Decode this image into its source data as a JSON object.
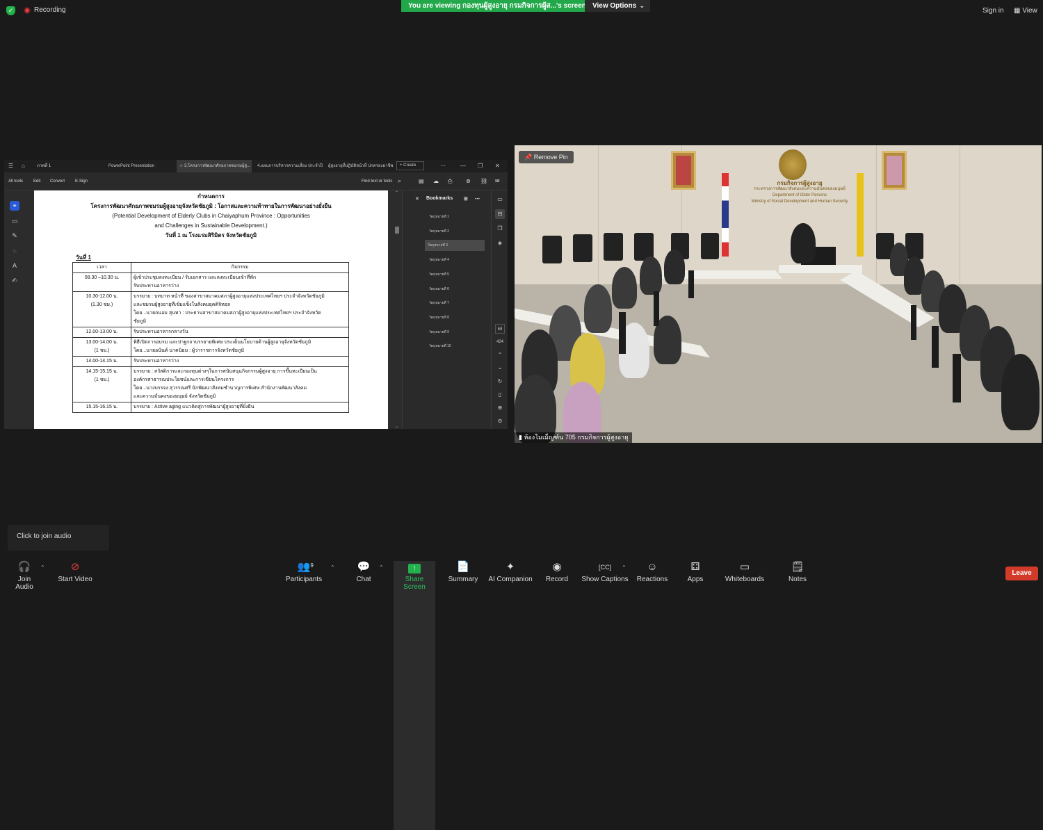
{
  "topbar": {
    "recording_label": "Recording",
    "viewing_banner": "You are viewing กองทุนผู้สูงอายุ กรมกิจการผู้ส...'s screen",
    "view_options_label": "View Options",
    "sign_in_label": "Sign in",
    "view_label": "View"
  },
  "shared_screen": {
    "tabs": [
      {
        "label": "ภาพที่ 1"
      },
      {
        "label": "PowerPoint Presentation"
      },
      {
        "label": "3.โครงการพัฒนาศักยภาพชมรมผู้สู..."
      },
      {
        "label": "4.แผนการบริหารความเสี่ยง ประจำปีง..."
      },
      {
        "label": "ผู้สูงอายุที่ปฏิบัติหน้าที่ ปกครองอาชีพ..."
      },
      {
        "label": "+ Create"
      }
    ],
    "toolbar": {
      "all_tools": "All tools",
      "edit": "Edit",
      "convert": "Convert",
      "esign": "E-Sign",
      "find": "Find text or tools"
    },
    "document": {
      "heading": "กำหนดการ",
      "title_line": "โครงการพัฒนาศักยภาพชมรมผู้สูงอายุจังหวัดชัยภูมิ : โอกาสและความท้าทายในการพัฒนาอย่างยั่งยืน",
      "subtitle_line1": "(Potential Development of Elderly Clubs in  Chaiyaphum Province : Opportunities",
      "subtitle_line2": "and Challenges in Sustainable Development.)",
      "venue_line": "วันที่  1 ณ  โรงแรมสิริมิตร จังหวัดชัยภูมิ",
      "day_label": "วันที่ 1",
      "col_time": "เวลา",
      "col_activity": "กิจกรรม",
      "rows": [
        {
          "time": "08.30 –10.30 น.",
          "activity": [
            "ผู้เข้าประชุมลงทะเบียน / รับเอกสาร และลงทะเบียนเข้าที่พัก",
            "รับประทานอาหารว่าง"
          ]
        },
        {
          "time": "10.30-12.00 น.\n(1.30 ชม.)",
          "activity": [
            "บรรยาย : บทบาท หน้าที่ ของสาขาสมาคมสภาผู้สูงอายุแห่งประเทศไทยฯ ประจำจังหวัดชัยภูมิ",
            "และชมรมผู้สูงอายุที่เข้มแข็งในสังคมยุคดิจิทอล",
            "โดย...นายถนอม  สุนทา : ประธานสาขาสมาคมสภาผู้สูงอายุแห่งประเทศไทยฯ ประจำจังหวัด",
            "ชัยภูมิ"
          ]
        },
        {
          "time": "12.00-13.00 น.",
          "activity": [
            "รับประทานอาหารกลางวัน"
          ]
        },
        {
          "time": "13.00-14.00 น.\n(1 ชม.)",
          "activity": [
            "พิธีเปิดการอบรม  และปาฐกถาบรรยายพิเศษ ประเด็นนโยบายด้านผู้สูงอายุจังหวัดชัยภูมิ",
            "โดย...นายอนันต์   นาคนิยม : ผู้ว่าราชการจังหวัดชัยภูมิ"
          ]
        },
        {
          "time": "14.00-14.15 น.",
          "activity": [
            "รับประทานอาหารว่าง"
          ]
        },
        {
          "time": "14.15-15.15 น.\n(1 ชม.)",
          "activity": [
            "บรรยาย : สวัสดิการและกองทุนต่างๆในการสนับสนุนกิจกรรมผู้สูงอายุ การขึ้นทะเบียนเป็น",
            "องค์กรสาธารณประโยชน์และการเขียนโครงการ",
            "โดย...นางบรรจง สุวรรณศรี นักพัฒนาสังคมชำนาญการพิเศษ สำนักงานพัฒนาสังคม",
            "และความมั่นคงของมนุษย์ จังหวัดชัยภูมิ"
          ]
        },
        {
          "time": "15.15-16.15 น.",
          "activity": [
            "บรรยาย : Active aging แนวคิดสู่การพัฒนาผู้สูงอายุที่ยั่งยืน"
          ]
        }
      ]
    },
    "bookmarks": {
      "title": "Bookmarks",
      "items": [
        "วัตถุหมายที่ 1",
        "วัตถุหมายที่ 2",
        "วัตถุหมายที่ 3",
        "วัตถุหมายที่ 4",
        "วัตถุหมายที่ 5",
        "วัตถุหมายที่ 6",
        "วัตถุหมายที่ 7",
        "วัตถุหมายที่ 8",
        "วัตถุหมายที่ 9",
        "วัตถุหมายที่ 10"
      ],
      "selected_index": 2
    },
    "page_indicator": {
      "current": "59",
      "total": "424"
    }
  },
  "video": {
    "remove_pin_label": "Remove Pin",
    "caption": "ห้องโมเม็ญฑ์น 705 กรมกิจการผู้สูงอายุ",
    "sign_line1": "กรมกิจการผู้สูงอายุ",
    "sign_line2": "กระทรวงการพัฒนาสังคมและความมั่นคงของมนุษย์",
    "sign_line3": "Department of Older Persons",
    "sign_line4": "Ministry of Social Development and Human Security"
  },
  "audio_popup": {
    "text": "Click to join audio"
  },
  "bottombar": {
    "join_audio": "Join Audio",
    "start_video": "Start Video",
    "participants": "Participants",
    "participants_count": "9",
    "chat": "Chat",
    "share_screen": "Share Screen",
    "summary": "Summary",
    "ai_companion": "AI Companion",
    "record": "Record",
    "show_captions": "Show Captions",
    "reactions": "Reactions",
    "apps": "Apps",
    "whiteboards": "Whiteboards",
    "notes": "Notes",
    "leave": "Leave"
  }
}
